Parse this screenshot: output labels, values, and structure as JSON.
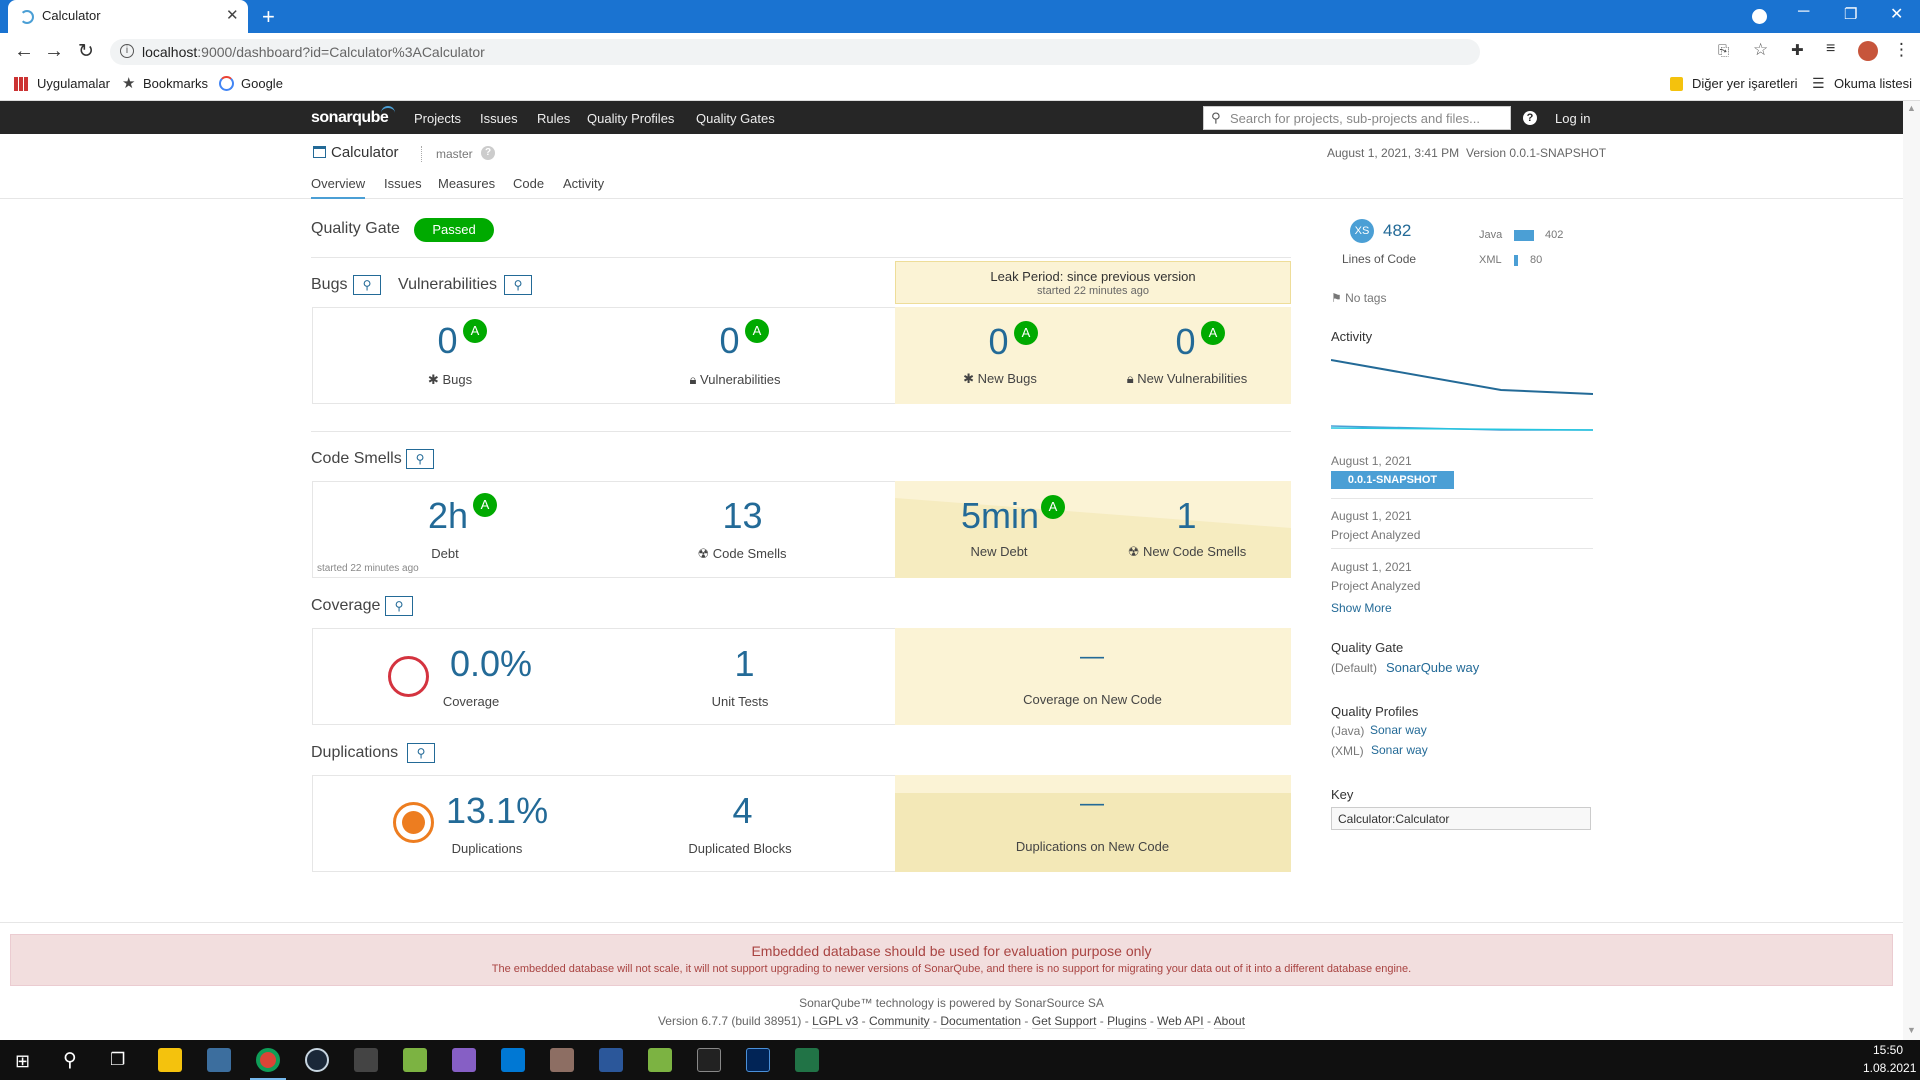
{
  "browser": {
    "tab_title": "Calculator",
    "url_host": "localhost",
    "url_rest": ":9000/dashboard?id=Calculator%3ACalculator",
    "bookmarks": [
      "Uygulamalar",
      "Bookmarks",
      "Google"
    ],
    "bookmarks_right": [
      "Diğer yer işaretleri",
      "Okuma listesi"
    ]
  },
  "sonar_nav": {
    "logo": "sonarqube",
    "links": [
      "Projects",
      "Issues",
      "Rules",
      "Quality Profiles",
      "Quality Gates"
    ],
    "search_placeholder": "Search for projects, sub-projects and files...",
    "help": "?",
    "login": "Log in"
  },
  "project": {
    "name": "Calculator",
    "branch": "master",
    "date": "August 1, 2021, 3:41 PM",
    "version": "Version 0.0.1-SNAPSHOT",
    "tabs": [
      "Overview",
      "Issues",
      "Measures",
      "Code",
      "Activity"
    ]
  },
  "quality_gate": {
    "label": "Quality Gate",
    "status": "Passed"
  },
  "reliability": {
    "heading_bugs": "Bugs",
    "heading_vulns": "Vulnerabilities",
    "leak_title": "Leak Period: since previous version",
    "leak_started": "started 22 minutes ago",
    "bugs": "0",
    "bugs_label": "Bugs",
    "bugs_rating": "A",
    "vulns": "0",
    "vulns_label": "Vulnerabilities",
    "vulns_rating": "A",
    "new_bugs": "0",
    "new_bugs_label": "New Bugs",
    "new_bugs_rating": "A",
    "new_vulns": "0",
    "new_vulns_label": "New Vulnerabilities",
    "new_vulns_rating": "A"
  },
  "smells": {
    "heading": "Code Smells",
    "debt": "2h",
    "debt_label": "Debt",
    "debt_rating": "A",
    "debt_started": "started 22 minutes ago",
    "smells": "13",
    "smells_label": "Code Smells",
    "new_debt": "5min",
    "new_debt_label": "New Debt",
    "new_debt_rating": "A",
    "new_smells": "1",
    "new_smells_label": "New Code Smells"
  },
  "coverage": {
    "heading": "Coverage",
    "value": "0.0%",
    "label": "Coverage",
    "tests": "1",
    "tests_label": "Unit Tests",
    "new_value": "—",
    "new_label": "Coverage on New Code"
  },
  "duplications": {
    "heading": "Duplications",
    "value": "13.1%",
    "label": "Duplications",
    "blocks": "4",
    "blocks_label": "Duplicated Blocks",
    "new_value": "—",
    "new_label": "Duplications on New Code"
  },
  "sidebar": {
    "size_badge": "XS",
    "loc": "482",
    "loc_label": "Lines of Code",
    "languages": [
      {
        "name": "Java",
        "value": "402",
        "fraction": 0.834
      },
      {
        "name": "XML",
        "value": "80",
        "fraction": 0.166
      }
    ],
    "tags": "No tags",
    "activity_title": "Activity",
    "events": [
      {
        "date": "August 1, 2021",
        "badge": "0.0.1-SNAPSHOT"
      },
      {
        "date": "August 1, 2021",
        "text": "Project Analyzed"
      },
      {
        "date": "August 1, 2021",
        "text": "Project Analyzed"
      }
    ],
    "show_more": "Show More",
    "qg_title": "Quality Gate",
    "qg_default": "(Default)",
    "qg_name": "SonarQube way",
    "qp_title": "Quality Profiles",
    "qp": [
      {
        "lang": "(Java)",
        "name": "Sonar way"
      },
      {
        "lang": "(XML)",
        "name": "Sonar way"
      }
    ],
    "key_title": "Key",
    "key": "Calculator:Calculator"
  },
  "warning": {
    "title": "Embedded database should be used for evaluation purpose only",
    "text": "The embedded database will not scale, it will not support upgrading to newer versions of SonarQube, and there is no support for migrating your data out of it into a different database engine."
  },
  "footer": {
    "line1": "SonarQube™ technology is powered by SonarSource SA",
    "version": "Version 6.7.7 (build 38951)",
    "links": [
      "LGPL v3",
      "Community",
      "Documentation",
      "Get Support",
      "Plugins",
      "Web API",
      "About"
    ]
  },
  "taskbar": {
    "time": "15:50",
    "date": "1.08.2021"
  },
  "colors": {
    "accent": "#236a97",
    "passed": "#00aa00",
    "leak": "#fbf3d5",
    "coverage_ring": "#d4333f",
    "dup_ring": "#ed7d20"
  }
}
